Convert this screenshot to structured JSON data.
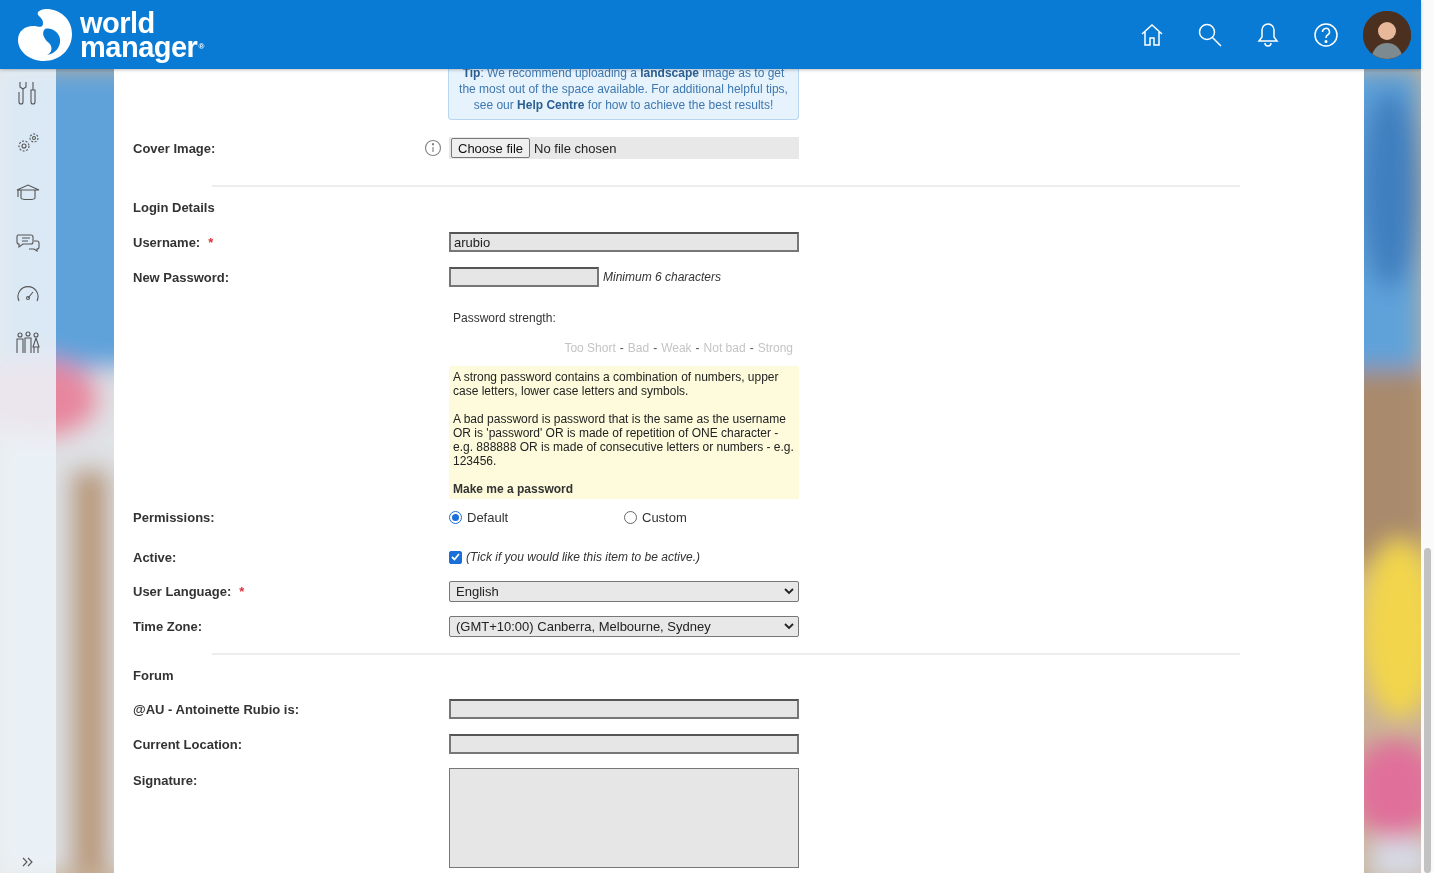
{
  "header": {
    "logo_line1": "world",
    "logo_line2": "manager",
    "logo_mark": "®"
  },
  "sidebar": {
    "items": [
      {
        "kind": "tools"
      },
      {
        "kind": "gears"
      },
      {
        "kind": "training"
      },
      {
        "kind": "chat"
      },
      {
        "kind": "gauge"
      },
      {
        "kind": "people"
      }
    ]
  },
  "tip": "**Tip**: We recommend uploading a **landscape** image as to get the most out of the space available. For additional helpful tips, see our **Help Centre** for how to achieve the best results!",
  "cover_image": {
    "label": "Cover Image:",
    "button": "Choose file",
    "status": "No file chosen"
  },
  "login_details": {
    "heading": "Login Details",
    "username": {
      "label": "Username:",
      "required_mark": "*",
      "value": "arubio"
    },
    "new_password": {
      "label": "New Password:",
      "hint": "Minimum 6 characters"
    },
    "strength_label": "Password strength:",
    "strength_levels": [
      "Too Short",
      "Bad",
      "Weak",
      "Not bad",
      "Strong"
    ],
    "strength_separator": "-",
    "advice": [
      "A strong password contains a combination of numbers, upper case letters, lower case letters and symbols.",
      "A bad password is password that is the same as the username OR is 'password' OR is made of repetition of ONE character - e.g. 888888 OR is made of consecutive letters or numbers - e.g. 123456."
    ],
    "make_password": "Make me a password",
    "permissions": {
      "label": "Permissions:",
      "options": [
        {
          "label": "Default",
          "selected": true
        },
        {
          "label": "Custom",
          "selected": false
        }
      ]
    },
    "active": {
      "label": "Active:",
      "checked": true,
      "note": "(Tick if you would like this item to be active.)"
    },
    "user_language": {
      "label": "User Language:",
      "required_mark": "*",
      "value": "English"
    },
    "time_zone": {
      "label": "Time Zone:",
      "value": "(GMT+10:00) Canberra, Melbourne, Sydney"
    }
  },
  "forum": {
    "heading": "Forum",
    "status": {
      "label": "@AU - Antoinette Rubio is:"
    },
    "location": {
      "label": "Current Location:"
    },
    "signature": {
      "label": "Signature:"
    }
  }
}
